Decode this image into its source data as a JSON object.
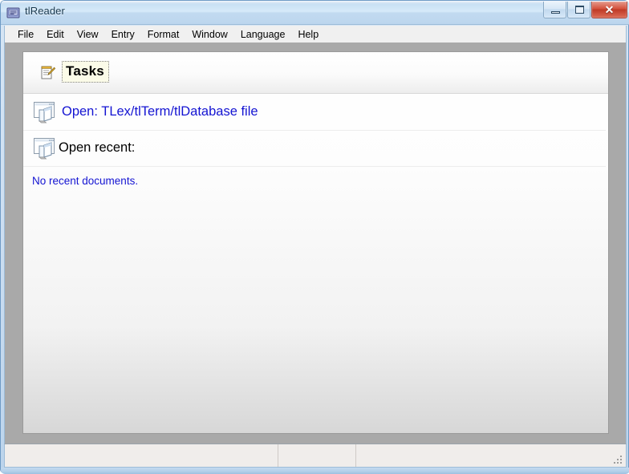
{
  "window": {
    "title": "tlReader",
    "app_icon": "book-icon",
    "controls": {
      "minimize": "Minimize",
      "maximize": "Maximize",
      "close": "Close",
      "close_glyph": "✕"
    },
    "colors": {
      "titlebar_top": "#c9e0f4",
      "titlebar_bottom": "#bcd6ee",
      "close_button": "#d4513c",
      "client_background": "#a9a9a9",
      "panel_background": "#ffffff",
      "link": "#1414d2"
    }
  },
  "menubar": {
    "items": [
      {
        "label": "File"
      },
      {
        "label": "Edit"
      },
      {
        "label": "View"
      },
      {
        "label": "Entry"
      },
      {
        "label": "Format"
      },
      {
        "label": "Window"
      },
      {
        "label": "Language"
      },
      {
        "label": "Help"
      }
    ]
  },
  "tasks_panel": {
    "icon": "notepad-pencil-icon",
    "title": "Tasks",
    "rows": [
      {
        "icon": "open-folder-window-icon",
        "label": "Open: TLex/tlTerm/tlDatabase file",
        "is_link": true
      },
      {
        "icon": "open-folder-window-icon",
        "label": "Open recent:",
        "is_link": false
      }
    ],
    "empty_message": "No recent documents."
  },
  "statusbar": {
    "panels": [
      {
        "text": ""
      },
      {
        "text": ""
      },
      {
        "text": ""
      }
    ],
    "resize_grip": "resize-grip-icon"
  }
}
